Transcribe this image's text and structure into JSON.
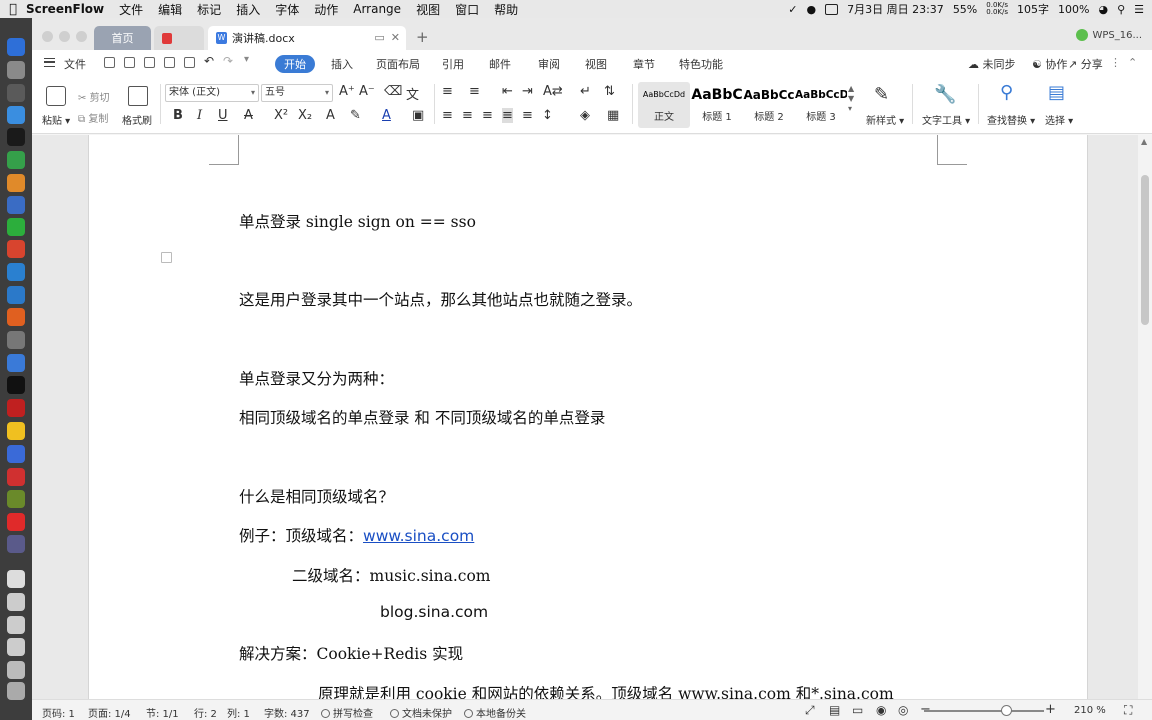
{
  "menubar": {
    "items": [
      "ScreenFlow",
      "文件",
      "编辑",
      "标记",
      "插入",
      "字体",
      "动作",
      "Arrange",
      "视图",
      "窗口",
      "帮助"
    ],
    "datetime": "7月3日 周日 23:37",
    "battery_pct": "55%",
    "net_up": "0.0K/s",
    "net_down": "0.0K/s",
    "word_count_widget": "105字",
    "battery2": "100%"
  },
  "tabs": {
    "home": "首页",
    "doc": "演讲稿.docx",
    "account": "WPS_16..."
  },
  "ribbon_tabs": {
    "file": "文件",
    "items": [
      "开始",
      "插入",
      "页面布局",
      "引用",
      "邮件",
      "审阅",
      "视图",
      "章节",
      "特色功能"
    ],
    "right": [
      "未同步",
      "协作",
      "分享"
    ]
  },
  "toolbar": {
    "paste": "粘贴",
    "cut": "剪切",
    "copy": "复制",
    "format_painter": "格式刷",
    "font_name": "宋体 (正文)",
    "font_size": "五号",
    "styles": [
      {
        "sample": "AaBbCcDd",
        "label": "正文"
      },
      {
        "sample": "AaBbC",
        "label": "标题 1"
      },
      {
        "sample": "AaBbCc",
        "label": "标题 2"
      },
      {
        "sample": "AaBbCcD",
        "label": "标题 3"
      }
    ],
    "new_style": "新样式",
    "text_tools": "文字工具",
    "find_replace": "查找替换",
    "select": "选择"
  },
  "document": {
    "lines": [
      "单点登录 single sign on == sso",
      "这是用户登录其中一个站点，那么其他站点也就随之登录。",
      "单点登录又分为两种：",
      "相同顶级域名的单点登录  和  不同顶级域名的单点登录",
      "什么是相同顶级域名？",
      "例子：顶级域名：",
      "www.sina.com",
      "二级域名：music.sina.com",
      "blog.sina.com",
      "解决方案：Cookie+Redis 实现",
      "原理就是利用 cookie 和网站的依赖关系。顶级域名 www.sina.com 和*.sina.com"
    ]
  },
  "statusbar": {
    "page_code": "页码: 1",
    "page": "页面: 1/4",
    "section": "节: 1/1",
    "row": "行: 2",
    "col": "列: 1",
    "words": "字数: 437",
    "spell": "拼写检查",
    "protect": "文档未保护",
    "backup": "本地备份关",
    "zoom": "210 %",
    "zoom_level": 0.68
  }
}
